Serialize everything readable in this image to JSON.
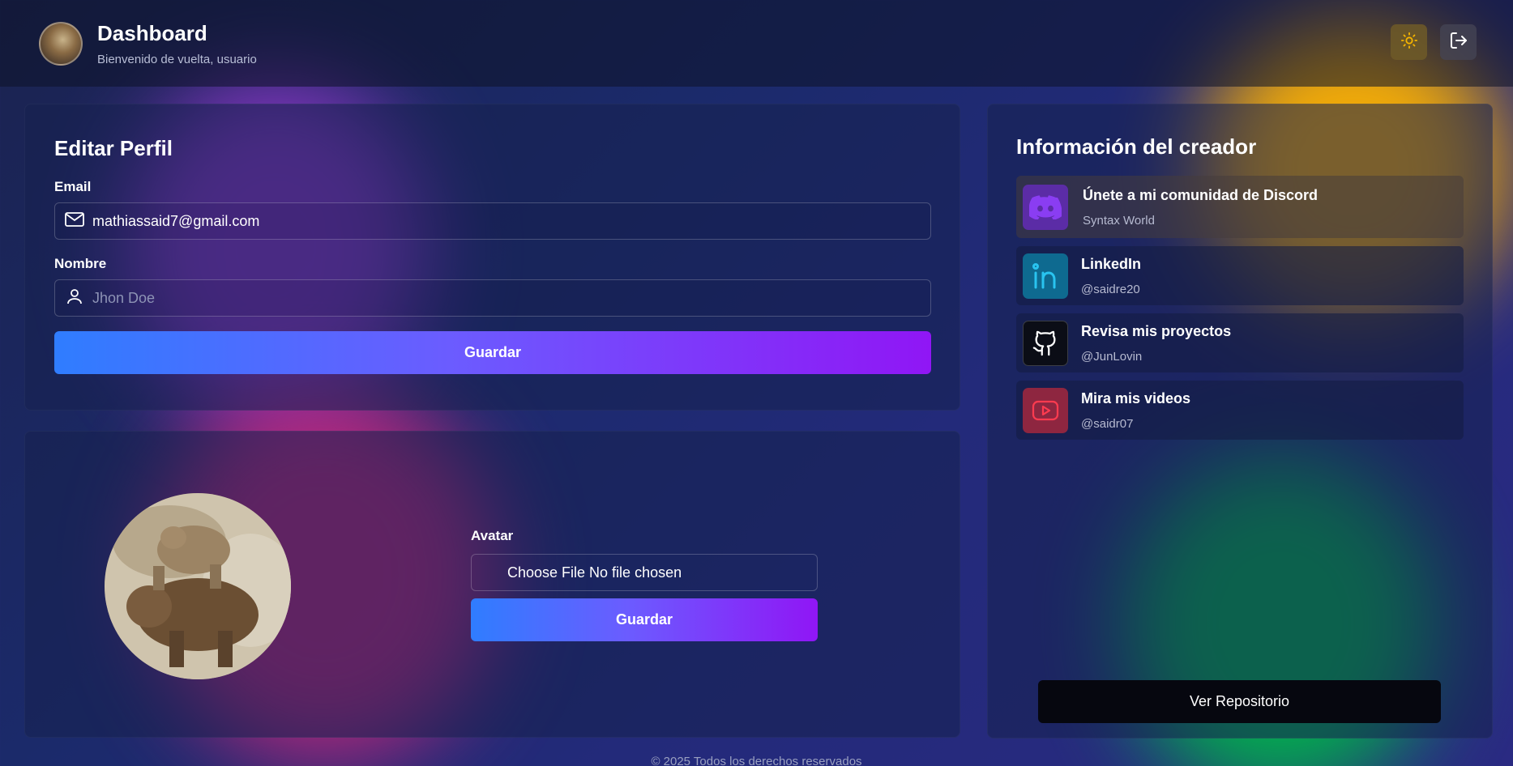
{
  "header": {
    "title": "Dashboard",
    "subtitle": "Bienvenido de vuelta, usuario"
  },
  "profile": {
    "title": "Editar Perfil",
    "email_label": "Email",
    "email_value": "mathiassaid7@gmail.com",
    "name_label": "Nombre",
    "name_placeholder": "Jhon Doe",
    "save_label": "Guardar"
  },
  "avatar": {
    "label": "Avatar",
    "file_text": "Choose File No file chosen",
    "save_label": "Guardar"
  },
  "creator": {
    "title": "Información del creador",
    "links": [
      {
        "title": "Únete a mi comunidad de Discord",
        "sub": "Syntax World",
        "icon": "discord-icon"
      },
      {
        "title": "LinkedIn",
        "sub": "@saidre20",
        "icon": "linkedin-icon"
      },
      {
        "title": "Revisa mis proyectos",
        "sub": "@JunLovin",
        "icon": "github-icon"
      },
      {
        "title": "Mira mis videos",
        "sub": "@saidr07",
        "icon": "youtube-icon"
      }
    ],
    "repo_label": "Ver Repositorio"
  },
  "footer": {
    "text": "© 2025 Todos los derechos reservados"
  },
  "colors": {
    "accent_start": "#2f7dff",
    "accent_end": "#9016f5",
    "theme_icon": "#f5b400"
  }
}
